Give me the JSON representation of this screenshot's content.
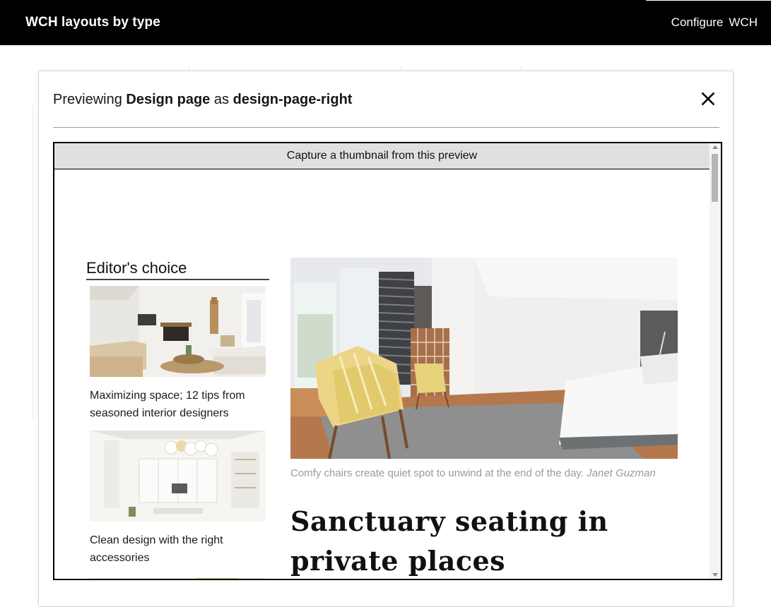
{
  "app": {
    "title": "WCH layouts by type",
    "nav": [
      {
        "label": "Configure"
      },
      {
        "label": "WCH"
      }
    ]
  },
  "modal": {
    "title_prefix": "Previewing",
    "content_type": "Design page",
    "title_middle": "as",
    "layout_name": "design-page-right",
    "close_icon": "close-icon"
  },
  "preview": {
    "capture_button": "Capture a thumbnail from this preview",
    "sidebar": {
      "heading": "Editor's choice",
      "items": [
        {
          "caption": "Maximizing space; 12 tips from seasoned interior designers"
        },
        {
          "caption": "Clean design with the right accessories"
        }
      ]
    },
    "article": {
      "image_caption": "Comfy chairs create quiet spot to unwind at the end of the day.",
      "image_credit": "Janet Guzman",
      "headline": "Sanctuary seating in private places"
    }
  },
  "colors": {
    "topbar": "#000000",
    "modal_rule": "#8ea0ad",
    "capture_bar": "#e0e0e0",
    "caption_text": "#9a9a9a"
  }
}
